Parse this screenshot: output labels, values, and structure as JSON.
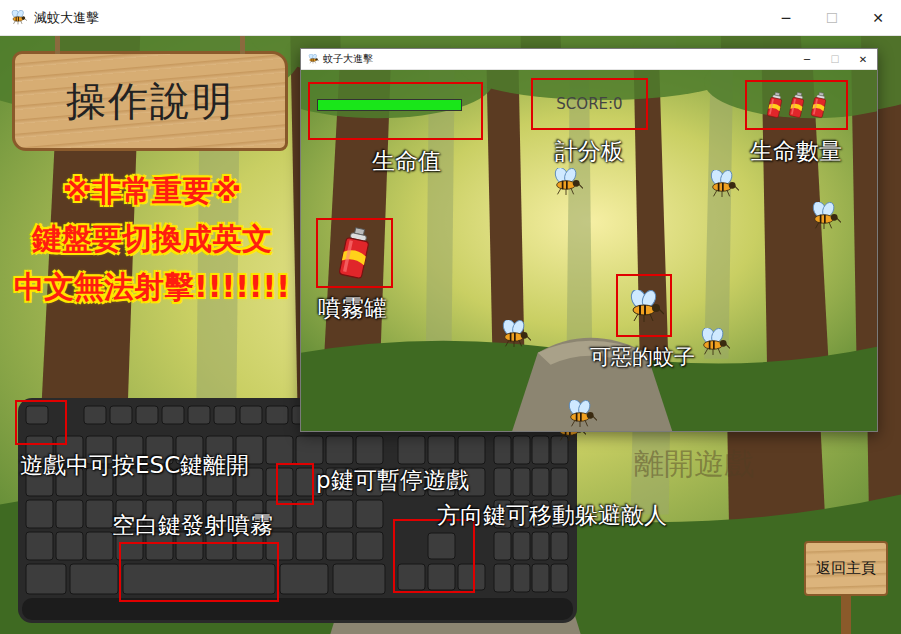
{
  "window": {
    "title": "滅蚊大進擊",
    "controls": [
      {
        "label": "─",
        "disabled": false
      },
      {
        "label": "☐",
        "disabled": true
      },
      {
        "label": "✕",
        "disabled": false
      }
    ]
  },
  "sign": {
    "title": "操作說明"
  },
  "warning": [
    "※非常重要※",
    "鍵盤要切換成英文",
    "中文無法射擊!!!!!!!"
  ],
  "preview": {
    "title": "蚊子大進擊",
    "controls": [
      {
        "label": "─",
        "disabled": false
      },
      {
        "label": "☐",
        "disabled": true
      },
      {
        "label": "✕",
        "disabled": false
      }
    ],
    "health": {
      "level": 1
    },
    "score": "SCORE:0",
    "lives": 3,
    "labels": {
      "health": "生命值",
      "score": "計分板",
      "lives": "生命數量",
      "spray": "噴霧罐",
      "mosquito": "可惡的蚊子"
    }
  },
  "keyboard_tips": {
    "esc": "遊戲中可按ESC鍵離開",
    "pause": "p鍵可暫停遊戲",
    "fire": "空白鍵發射噴霧",
    "move": "方向鍵可移動躲避敵人"
  },
  "exit_button": {
    "label": "離開遊戲",
    "disabled": true
  },
  "back_button": {
    "label": "返回主頁"
  }
}
